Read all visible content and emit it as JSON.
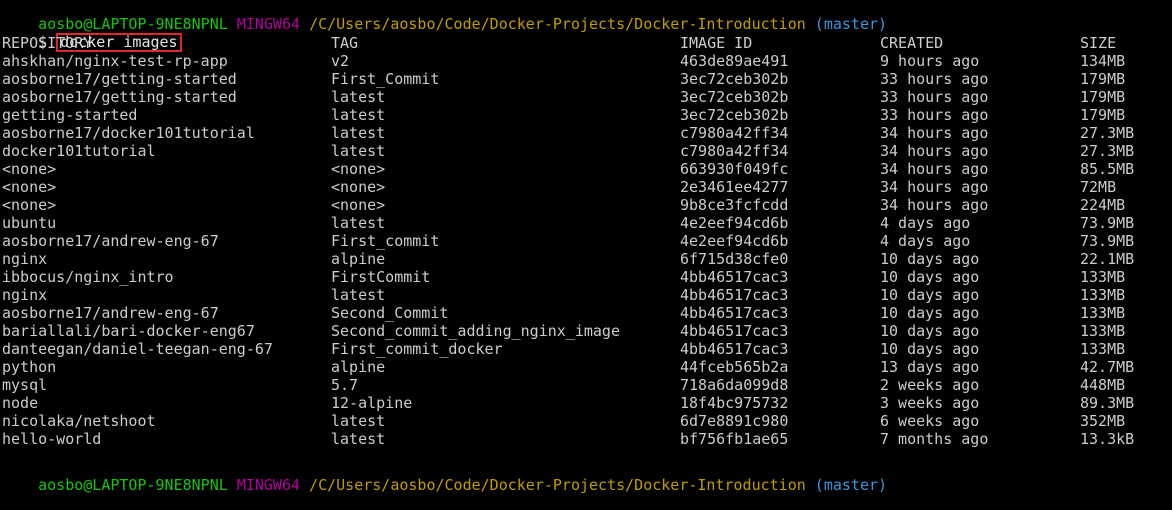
{
  "prompt": {
    "user_host": "aosbo@LAPTOP-9NE8NPNL",
    "shell": "MINGW64",
    "path": "/C/Users/aosbo/Code/Docker-Projects/Docker-Introduction",
    "branch": "(master)",
    "symbol": "$"
  },
  "command": "docker images",
  "table": {
    "headers": {
      "repository": "REPOSITORY",
      "tag": "TAG",
      "image_id": "IMAGE ID",
      "created": "CREATED",
      "size": "SIZE"
    },
    "rows": [
      {
        "repository": "ahskhan/nginx-test-rp-app",
        "tag": "v2",
        "image_id": "463de89ae491",
        "created": "9 hours ago",
        "size": "134MB"
      },
      {
        "repository": "aosborne17/getting-started",
        "tag": "First_Commit",
        "image_id": "3ec72ceb302b",
        "created": "33 hours ago",
        "size": "179MB"
      },
      {
        "repository": "aosborne17/getting-started",
        "tag": "latest",
        "image_id": "3ec72ceb302b",
        "created": "33 hours ago",
        "size": "179MB"
      },
      {
        "repository": "getting-started",
        "tag": "latest",
        "image_id": "3ec72ceb302b",
        "created": "33 hours ago",
        "size": "179MB"
      },
      {
        "repository": "aosborne17/docker101tutorial",
        "tag": "latest",
        "image_id": "c7980a42ff34",
        "created": "34 hours ago",
        "size": "27.3MB"
      },
      {
        "repository": "docker101tutorial",
        "tag": "latest",
        "image_id": "c7980a42ff34",
        "created": "34 hours ago",
        "size": "27.3MB"
      },
      {
        "repository": "<none>",
        "tag": "<none>",
        "image_id": "663930f049fc",
        "created": "34 hours ago",
        "size": "85.5MB"
      },
      {
        "repository": "<none>",
        "tag": "<none>",
        "image_id": "2e3461ee4277",
        "created": "34 hours ago",
        "size": "72MB"
      },
      {
        "repository": "<none>",
        "tag": "<none>",
        "image_id": "9b8ce3fcfcdd",
        "created": "34 hours ago",
        "size": "224MB"
      },
      {
        "repository": "ubuntu",
        "tag": "latest",
        "image_id": "4e2eef94cd6b",
        "created": "4 days ago",
        "size": "73.9MB"
      },
      {
        "repository": "aosborne17/andrew-eng-67",
        "tag": "First_commit",
        "image_id": "4e2eef94cd6b",
        "created": "4 days ago",
        "size": "73.9MB"
      },
      {
        "repository": "nginx",
        "tag": "alpine",
        "image_id": "6f715d38cfe0",
        "created": "10 days ago",
        "size": "22.1MB"
      },
      {
        "repository": "ibbocus/nginx_intro",
        "tag": "FirstCommit",
        "image_id": "4bb46517cac3",
        "created": "10 days ago",
        "size": "133MB"
      },
      {
        "repository": "nginx",
        "tag": "latest",
        "image_id": "4bb46517cac3",
        "created": "10 days ago",
        "size": "133MB"
      },
      {
        "repository": "aosborne17/andrew-eng-67",
        "tag": "Second_Commit",
        "image_id": "4bb46517cac3",
        "created": "10 days ago",
        "size": "133MB"
      },
      {
        "repository": "bariallali/bari-docker-eng67",
        "tag": "Second_commit_adding_nginx_image",
        "image_id": "4bb46517cac3",
        "created": "10 days ago",
        "size": "133MB"
      },
      {
        "repository": "danteegan/daniel-teegan-eng-67",
        "tag": "First_commit_docker",
        "image_id": "4bb46517cac3",
        "created": "10 days ago",
        "size": "133MB"
      },
      {
        "repository": "python",
        "tag": "alpine",
        "image_id": "44fceb565b2a",
        "created": "13 days ago",
        "size": "42.7MB"
      },
      {
        "repository": "mysql",
        "tag": "5.7",
        "image_id": "718a6da099d8",
        "created": "2 weeks ago",
        "size": "448MB"
      },
      {
        "repository": "node",
        "tag": "12-alpine",
        "image_id": "18f4bc975732",
        "created": "3 weeks ago",
        "size": "89.3MB"
      },
      {
        "repository": "nicolaka/netshoot",
        "tag": "latest",
        "image_id": "6d7e8891c980",
        "created": "6 weeks ago",
        "size": "352MB"
      },
      {
        "repository": "hello-world",
        "tag": "latest",
        "image_id": "bf756fb1ae65",
        "created": "7 months ago",
        "size": "13.3kB"
      }
    ]
  },
  "colors": {
    "background": "#000000",
    "text": "#cccccc",
    "user_host": "#16c60c",
    "shell": "#b4009e",
    "path": "#c19c00",
    "branch": "#3a96dd",
    "highlight_box": "#e02828"
  }
}
